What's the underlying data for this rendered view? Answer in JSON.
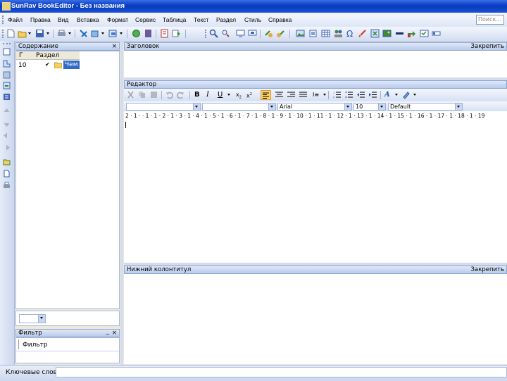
{
  "window": {
    "title": "SunRav BookEditor - Без названия"
  },
  "menu": {
    "items": [
      "Файл",
      "Правка",
      "Вид",
      "Вставка",
      "Формат",
      "Сервис",
      "Таблица",
      "Текст",
      "Раздел",
      "Стиль",
      "Справка"
    ]
  },
  "search": {
    "placeholder": "Поиск..."
  },
  "contents_panel": {
    "title": "Содержание",
    "close": "×",
    "columns": [
      "Г",
      "Раздел"
    ],
    "rows": [
      {
        "num": "10",
        "checked": "✔",
        "label": "Чем"
      }
    ]
  },
  "filter_panel": {
    "title": "Фильтр",
    "min": "_",
    "close": "×",
    "label": "Фильтр"
  },
  "header_panel": {
    "title": "Заголовок",
    "pin": "Закрепить"
  },
  "editor_panel": {
    "title": "Редактор"
  },
  "footer_panel": {
    "title": "Нижний колонтитул",
    "pin": "Закрепить"
  },
  "format": {
    "font": "Arial",
    "size": "10",
    "style": "Default"
  },
  "ruler": {
    "text": "2 · 1 · · 1 · 1 · 2 · 1 · 3 · 1 · 4 · 1 · 5 · 1 · 6 · 1 · 7 · 1 · 8 · 1 · 9 · 1 · 10 · 1 · 11 · 1 · 12 · 1 · 13 · 1 · 14 · 1 · 15 · 1 · 16 · 1 · 17 · 1 · 18 · 1 · 19"
  },
  "statusbar": {
    "text": "Ключевые слова"
  },
  "colors": {
    "titlebar": "#0a3fc4",
    "panel_header": "#b9cbeb",
    "accent": "#fbd36b"
  }
}
